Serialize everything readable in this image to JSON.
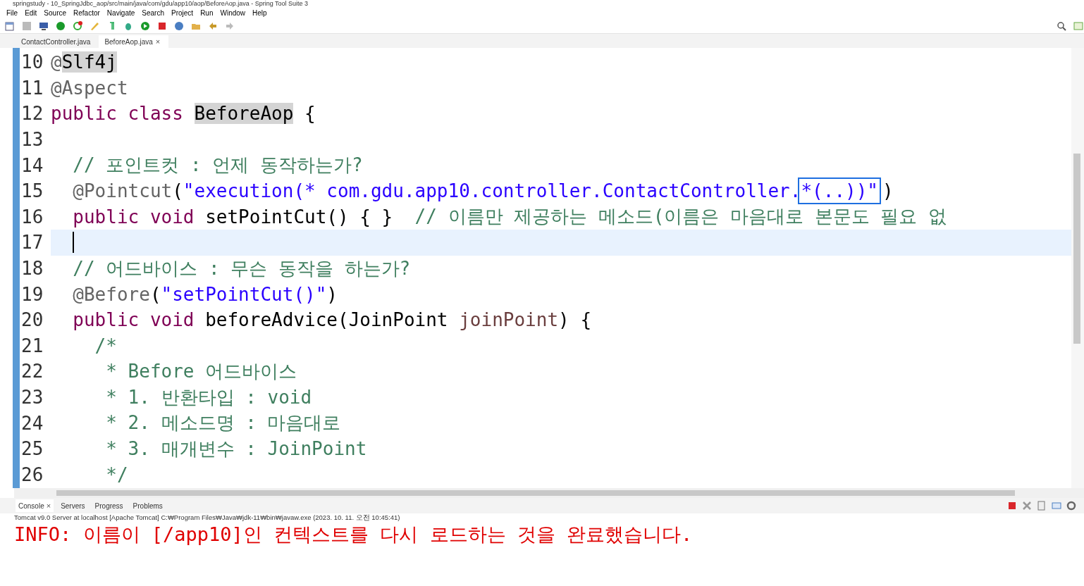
{
  "window": {
    "title": "springstudy - 10_SpringJdbc_aop/src/main/java/com/gdu/app10/aop/BeforeAop.java - Spring Tool Suite 3"
  },
  "menu": [
    "File",
    "Edit",
    "Source",
    "Refactor",
    "Navigate",
    "Search",
    "Project",
    "Run",
    "Window",
    "Help"
  ],
  "editor_tabs": [
    {
      "label": "ContactController.java",
      "selected": false
    },
    {
      "label": "BeforeAop.java",
      "selected": true,
      "close": "×"
    }
  ],
  "code_lines": [
    {
      "number": "10",
      "current": false,
      "tokens": [
        {
          "text": "@",
          "kind": "annotation"
        },
        {
          "text": "Slf4j",
          "kind": "occurrence"
        }
      ]
    },
    {
      "number": "11",
      "current": false,
      "tokens": [
        {
          "text": "@Aspect",
          "kind": "annotation"
        }
      ]
    },
    {
      "number": "12",
      "current": false,
      "tokens": [
        {
          "text": "public class ",
          "kind": "keyword"
        },
        {
          "text": "BeforeAop",
          "kind": "occurrence"
        },
        {
          "text": " {",
          "kind": "plain"
        }
      ]
    },
    {
      "number": "13",
      "current": false
    },
    {
      "number": "14",
      "current": false,
      "tokens": [
        {
          "text": "  // 포인트컷 : 언제 동작하는가?",
          "kind": "comment"
        }
      ]
    },
    {
      "number": "15",
      "current": false,
      "tokens": [
        {
          "text": "  @Pointcut",
          "kind": "annotation"
        },
        {
          "text": "(",
          "kind": "plain"
        },
        {
          "text": "\"execution(* com.gdu.app10.controller.ContactController.",
          "kind": "string"
        },
        {
          "text": "*(..))\"",
          "kind": "boxed"
        },
        {
          "text": ")",
          "kind": "plain"
        }
      ]
    },
    {
      "number": "16",
      "current": false,
      "tokens": [
        {
          "text": "  public void",
          "kind": "keyword"
        },
        {
          "text": " setPointCut() { }  ",
          "kind": "plain"
        },
        {
          "text": "// 이름만 제공하는 메소드(이름은 마음대로 본문도 필요 없",
          "kind": "comment"
        }
      ]
    },
    {
      "number": "17",
      "current": true
    },
    {
      "number": "18",
      "current": false,
      "tokens": [
        {
          "text": "  // 어드바이스 : 무슨 동작을 하는가?",
          "kind": "comment"
        }
      ]
    },
    {
      "number": "19",
      "current": false,
      "tokens": [
        {
          "text": "  @Before",
          "kind": "annotation"
        },
        {
          "text": "(",
          "kind": "plain"
        },
        {
          "text": "\"setPointCut()\"",
          "kind": "string"
        },
        {
          "text": ")",
          "kind": "plain"
        }
      ]
    },
    {
      "number": "20",
      "current": false,
      "tokens": [
        {
          "text": "  public void",
          "kind": "keyword"
        },
        {
          "text": " beforeAdvice(JoinPoint ",
          "kind": "plain"
        },
        {
          "text": "joinPoint",
          "kind": "param"
        },
        {
          "text": ") {",
          "kind": "plain"
        }
      ]
    },
    {
      "number": "21",
      "current": false,
      "tokens": [
        {
          "text": "    /*",
          "kind": "comment"
        }
      ]
    },
    {
      "number": "22",
      "current": false,
      "tokens": [
        {
          "text": "     * Before 어드바이스",
          "kind": "comment"
        }
      ]
    },
    {
      "number": "23",
      "current": false,
      "tokens": [
        {
          "text": "     * 1. 반환타입 : void",
          "kind": "comment"
        }
      ]
    },
    {
      "number": "24",
      "current": false,
      "tokens": [
        {
          "text": "     * 2. 메소드명 : 마음대로",
          "kind": "comment"
        }
      ]
    },
    {
      "number": "25",
      "current": false,
      "tokens": [
        {
          "text": "     * 3. 매개변수 : JoinPoint",
          "kind": "comment"
        }
      ]
    },
    {
      "number": "26",
      "current": false,
      "tokens": [
        {
          "text": "     */",
          "kind": "comment"
        }
      ]
    }
  ],
  "console": {
    "tabs": [
      {
        "label": "Console",
        "selected": true,
        "close": "×"
      },
      {
        "label": "Servers",
        "selected": false
      },
      {
        "label": "Progress",
        "selected": false
      },
      {
        "label": "Problems",
        "selected": false
      }
    ],
    "header": "Tomcat v9.0 Server at localhost [Apache Tomcat] C:₩Program Files₩Java₩jdk-11₩bin₩javaw.exe  (2023. 10. 11. 오전 10:45:41)",
    "output": "INFO: 이름이 [/app10]인 컨텍스트를 다시 로드하는 것을 완료했습니다."
  }
}
